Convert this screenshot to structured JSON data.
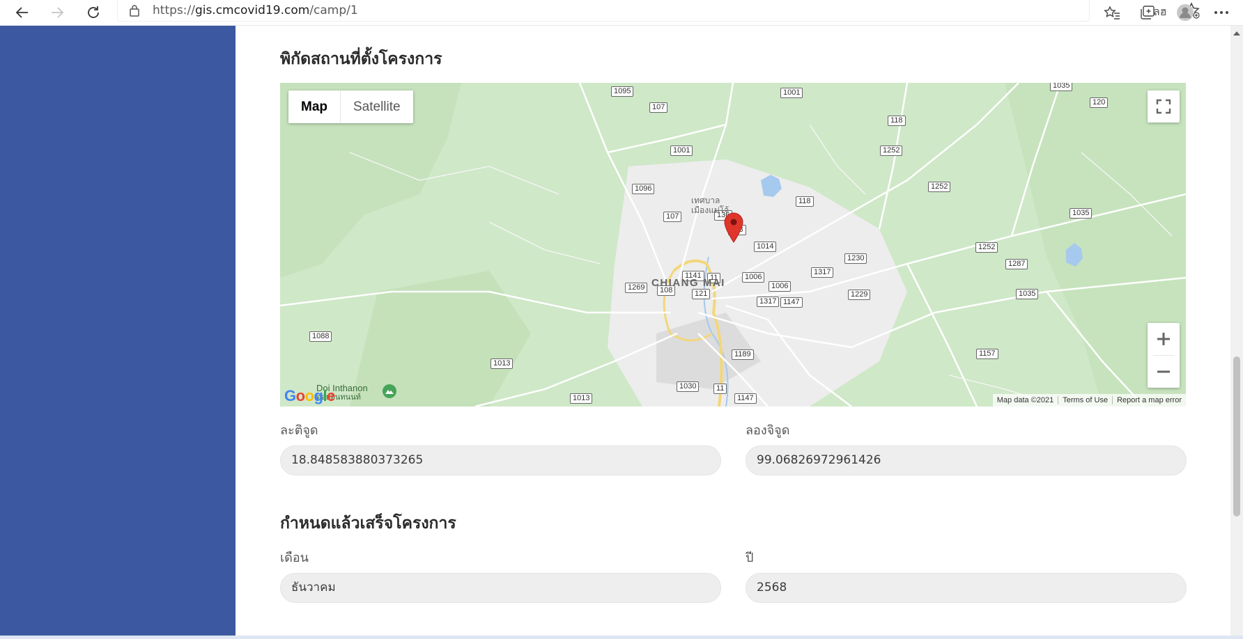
{
  "browser": {
    "url_prefix": "https://",
    "url_host": "gis.cmcovid19.com",
    "url_path": "/camp/1",
    "read_aloud_label": "ลฮ"
  },
  "location_section": {
    "title": "พิกัดสถานที่ตั้งโครงการ",
    "map": {
      "type_map_label": "Map",
      "type_satellite_label": "Satellite",
      "city_label": "CHIANG MAI",
      "municipality_label_line1": "เทศบาล",
      "municipality_label_line2": "เมืองแม่โจ้",
      "poi_label": "Doi Inthanon",
      "poi_label_th": "ดอยอินทนนท์",
      "google_logo": "Google",
      "attribution": {
        "map_data": "Map data ©2021",
        "terms": "Terms of Use",
        "report": "Report a map error"
      },
      "road_shields": [
        "1095",
        "1001",
        "107",
        "118",
        "1252",
        "120",
        "1035",
        "1001",
        "1096",
        "107",
        "136",
        "118",
        "118",
        "1252",
        "1035",
        "1014",
        "1230",
        "1317",
        "1141",
        "11",
        "1006",
        "1269",
        "108",
        "121",
        "1006",
        "1317",
        "1147",
        "1229",
        "1287",
        "1035",
        "1088",
        "1013",
        "1189",
        "1252",
        "1157",
        "1030",
        "11",
        "1147",
        "1013"
      ]
    },
    "latitude_label": "ละติจูด",
    "latitude_value": "18.848583880373265",
    "longitude_label": "ลองจิจูด",
    "longitude_value": "99.06826972961426"
  },
  "completion_section": {
    "title": "กำหนดแล้วเสร็จโครงการ",
    "month_label": "เดือน",
    "month_value": "ธันวาคม",
    "year_label": "ปี",
    "year_value": "2568"
  },
  "colors": {
    "sidebar": "#3c58a0",
    "map_green": "#cfe8c8",
    "map_urban": "#ededed",
    "marker_red": "#e0352b"
  }
}
